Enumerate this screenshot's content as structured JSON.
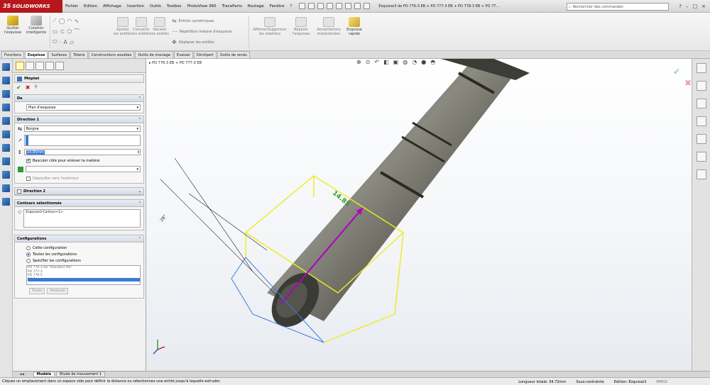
{
  "app": {
    "brand": "SOLIDWORKS",
    "brand_prefix": "3S",
    "menu": [
      "Fichier",
      "Edition",
      "Affichage",
      "Insertion",
      "Outils",
      "Toolbox",
      "PhotoView 360",
      "TraceParts",
      "Routage",
      "Fenêtre",
      "?"
    ],
    "doc_title": "Esquisse3 de PO 776-3 EB + PO 777-3 EB + PO 778-3 EB + PO 77...",
    "search_placeholder": "Rechercher des commandes"
  },
  "ribbon": {
    "exit_sketch": "Quitter l'esquisse",
    "smart_dim": "Cotation intelligente",
    "trim": "Ajuster les entités",
    "convert": "Convertir les entités",
    "offset": "Décaler les entités",
    "mirror": "Entités symétriques",
    "linear_pattern": "Répétition linéaire d'esquisse",
    "move": "Déplacer les entités",
    "relations": "Afficher/Supprimer les relations",
    "repair": "Réparer l'esquisse",
    "quick_snaps": "Aimantations instantanées",
    "rapid_sketch": "Esquisse rapide"
  },
  "tabs": [
    "Fonctions",
    "Esquisse",
    "Surfaces",
    "Tôlerie",
    "Constructions soudées",
    "Outils de moulage",
    "Evaluer",
    "DimXpert",
    "Outils de rendu"
  ],
  "active_tab": "Esquisse",
  "feature": {
    "title": "Méplat",
    "from_label": "De",
    "from_value": "Plan d'esquisse",
    "direction1_label": "Direction 1",
    "end_condition": "Borgne",
    "depth": "14.85mm",
    "flip_side_label": "Basculer côté pour enlever la matière",
    "flip_side_checked": true,
    "draft_outward_label": "Dépouiller vers l'extérieur",
    "direction2_label": "Direction 2",
    "contours_label": "Contours sélectionnés",
    "contour_item": "Esquisse3-Contour<1>",
    "configs_label": "Configurations",
    "config_options": [
      "Cette configuration",
      "Toutes les configurations",
      "Spécifier les configurations"
    ],
    "config_selected": "Toutes les configurations",
    "config_list": [
      "PO 776-3 EB \"Standard (M)\"",
      "PO 777-3",
      "PO 776-5",
      "PO 7..."
    ],
    "btn_all": "Toutes",
    "btn_reset": "Restaurer"
  },
  "viewport": {
    "breadcrumb": "PO 776-3 EB + PO 777-3 EB",
    "dim_label": "14.85",
    "angle_label": "28°"
  },
  "bottom_tabs": [
    "Modèle",
    "Etude de mouvement 1"
  ],
  "status": {
    "message": "Cliquez un emplacement dans un espace vide pour définir la distance ou sélectionnez une entité jusqu'à laquelle extruder.",
    "length": "Longueur totale: 34.72mm",
    "constraint": "Sous-contrainte",
    "edition": "Edition: Esquisse3",
    "units": "MMGS"
  }
}
